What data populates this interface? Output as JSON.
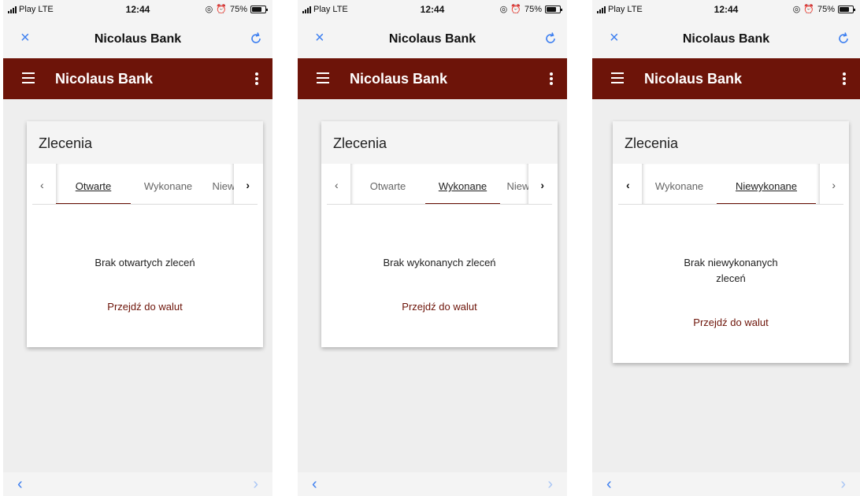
{
  "status": {
    "carrier": "Play",
    "network": "LTE",
    "time": "12:44",
    "battery": "75%",
    "battery_level": 0.75,
    "icons": [
      "location-icon",
      "alarm-icon"
    ]
  },
  "browser": {
    "title": "Nicolaus Bank",
    "close": "×",
    "back": "‹",
    "forward": "›"
  },
  "app": {
    "title": "Nicolaus Bank",
    "brand_color": "#6d1409"
  },
  "card": {
    "title": "Zlecenia",
    "link": "Przejdź do walut"
  },
  "tabs": [
    "Otwarte",
    "Wykonane",
    "Niewykonane"
  ],
  "screens": [
    {
      "active_tab": "Otwarte",
      "empty_message": "Brak otwartych zleceń"
    },
    {
      "active_tab": "Wykonane",
      "empty_message": "Brak wykonanych zleceń"
    },
    {
      "active_tab": "Niewykonane",
      "empty_message": "Brak niewykonanych zleceń"
    }
  ]
}
